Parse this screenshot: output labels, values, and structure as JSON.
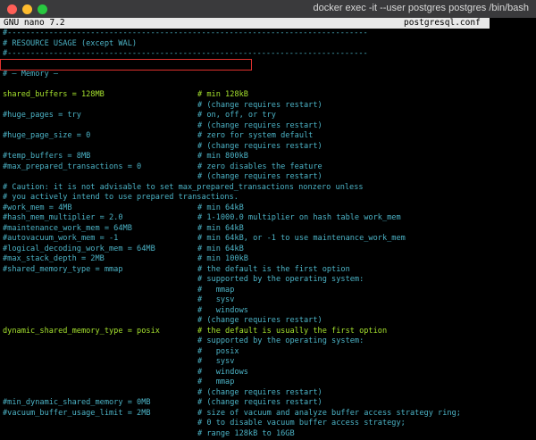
{
  "window": {
    "title": "docker exec -it --user postgres postgres /bin/bash"
  },
  "nano": {
    "name": "GNU nano 7.2",
    "filename": "postgresql.conf"
  },
  "lines": [
    {
      "code": "#------------------------------------------------------------------------------",
      "comment": "",
      "active": false
    },
    {
      "code": "# RESOURCE USAGE (except WAL)",
      "comment": "",
      "active": false
    },
    {
      "code": "#------------------------------------------------------------------------------",
      "comment": "",
      "active": false
    },
    {
      "code": "",
      "comment": "",
      "active": false
    },
    {
      "code": "# – Memory –",
      "comment": "",
      "active": false
    },
    {
      "code": "",
      "comment": "",
      "active": false
    },
    {
      "code": "shared_buffers = 128MB",
      "comment": "# min 128kB",
      "active": true
    },
    {
      "code": "",
      "comment": "# (change requires restart)",
      "active": false
    },
    {
      "code": "#huge_pages = try",
      "comment": "# on, off, or try",
      "active": false
    },
    {
      "code": "",
      "comment": "# (change requires restart)",
      "active": false
    },
    {
      "code": "#huge_page_size = 0",
      "comment": "# zero for system default",
      "active": false
    },
    {
      "code": "",
      "comment": "# (change requires restart)",
      "active": false
    },
    {
      "code": "#temp_buffers = 8MB",
      "comment": "# min 800kB",
      "active": false
    },
    {
      "code": "#max_prepared_transactions = 0",
      "comment": "# zero disables the feature",
      "active": false
    },
    {
      "code": "",
      "comment": "# (change requires restart)",
      "active": false
    },
    {
      "code": "# Caution: it is not advisable to set max_prepared_transactions nonzero unless",
      "comment": "",
      "active": false
    },
    {
      "code": "# you actively intend to use prepared transactions.",
      "comment": "",
      "active": false
    },
    {
      "code": "#work_mem = 4MB",
      "comment": "# min 64kB",
      "active": false
    },
    {
      "code": "#hash_mem_multiplier = 2.0",
      "comment": "# 1-1000.0 multiplier on hash table work_mem",
      "active": false
    },
    {
      "code": "#maintenance_work_mem = 64MB",
      "comment": "# min 64kB",
      "active": false
    },
    {
      "code": "#autovacuum_work_mem = -1",
      "comment": "# min 64kB, or -1 to use maintenance_work_mem",
      "active": false
    },
    {
      "code": "#logical_decoding_work_mem = 64MB",
      "comment": "# min 64kB",
      "active": false
    },
    {
      "code": "#max_stack_depth = 2MB",
      "comment": "# min 100kB",
      "active": false
    },
    {
      "code": "#shared_memory_type = mmap",
      "comment": "# the default is the first option",
      "active": false
    },
    {
      "code": "",
      "comment": "# supported by the operating system:",
      "active": false
    },
    {
      "code": "",
      "comment": "#   mmap",
      "active": false
    },
    {
      "code": "",
      "comment": "#   sysv",
      "active": false
    },
    {
      "code": "",
      "comment": "#   windows",
      "active": false
    },
    {
      "code": "",
      "comment": "# (change requires restart)",
      "active": false
    },
    {
      "code": "dynamic_shared_memory_type = posix",
      "comment": "# the default is usually the first option",
      "active": true
    },
    {
      "code": "",
      "comment": "# supported by the operating system:",
      "active": false
    },
    {
      "code": "",
      "comment": "#   posix",
      "active": false
    },
    {
      "code": "",
      "comment": "#   sysv",
      "active": false
    },
    {
      "code": "",
      "comment": "#   windows",
      "active": false
    },
    {
      "code": "",
      "comment": "#   mmap",
      "active": false
    },
    {
      "code": "",
      "comment": "# (change requires restart)",
      "active": false
    },
    {
      "code": "#min_dynamic_shared_memory = 0MB",
      "comment": "# (change requires restart)",
      "active": false
    },
    {
      "code": "#vacuum_buffer_usage_limit = 2MB",
      "comment": "# size of vacuum and analyze buffer access strategy ring;",
      "active": false
    },
    {
      "code": "",
      "comment": "# 0 to disable vacuum buffer access strategy;",
      "active": false
    },
    {
      "code": "",
      "comment": "# range 128kB to 16GB",
      "active": false
    }
  ],
  "colors": {
    "comment": "#4cb3c6",
    "setting": "#a6e22e",
    "highlight_box": "#e0312e"
  }
}
